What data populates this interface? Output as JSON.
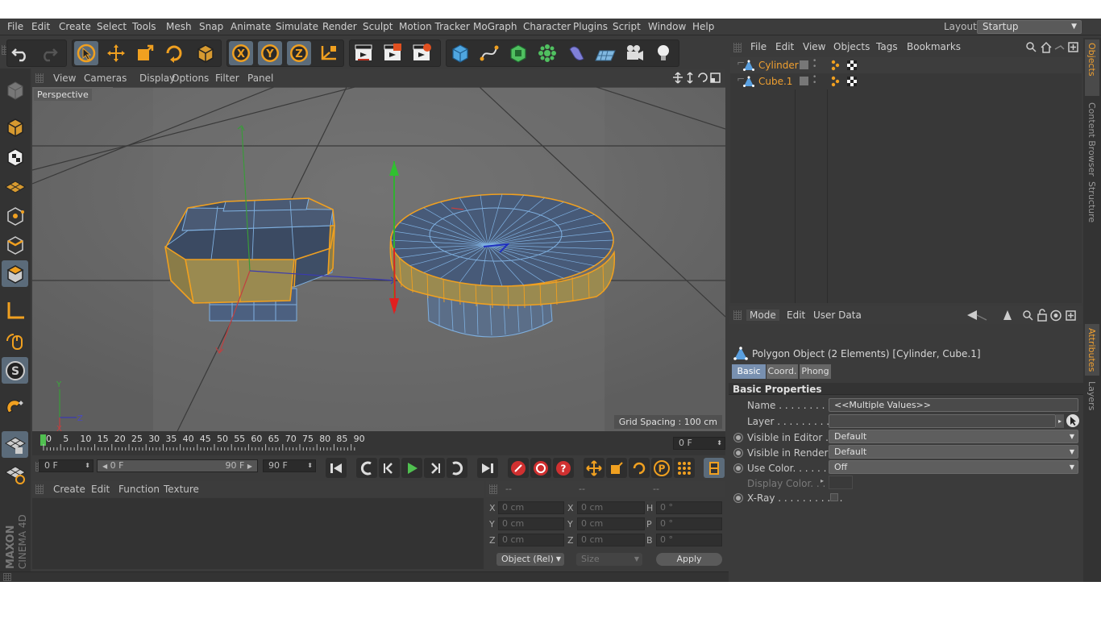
{
  "menu": {
    "items": [
      "File",
      "Edit",
      "Create",
      "Select",
      "Tools",
      "Mesh",
      "Snap",
      "Animate",
      "Simulate",
      "Render",
      "Sculpt",
      "Motion Tracker",
      "MoGraph",
      "Character",
      "Plugins",
      "Script",
      "Window",
      "Help"
    ],
    "layout_label": "Layout:",
    "layout_value": "Startup"
  },
  "viewport": {
    "menu": [
      "View",
      "Cameras",
      "Display",
      "Options",
      "Filter",
      "Panel"
    ],
    "name": "Perspective",
    "grid_spacing": "Grid Spacing : 100 cm",
    "axis_y": "Y",
    "axis_z": "Z",
    "axis_x": "X"
  },
  "timeline": {
    "ticks": [
      "0",
      "5",
      "10",
      "15",
      "20",
      "25",
      "30",
      "35",
      "40",
      "45",
      "50",
      "55",
      "60",
      "65",
      "70",
      "75",
      "80",
      "85",
      "90"
    ],
    "current_frame": "0 F",
    "start_field": "0 F",
    "range_start": "0 F",
    "range_end": "90 F",
    "end_field": "90 F"
  },
  "material": {
    "menu": [
      "Create",
      "Edit",
      "Function",
      "Texture"
    ]
  },
  "coords": {
    "headers": [
      "--",
      "--",
      "--"
    ],
    "pos": [
      {
        "label": "X",
        "value": "0 cm"
      },
      {
        "label": "Y",
        "value": "0 cm"
      },
      {
        "label": "Z",
        "value": "0 cm"
      }
    ],
    "size": [
      {
        "label": "X",
        "value": "0 cm"
      },
      {
        "label": "Y",
        "value": "0 cm"
      },
      {
        "label": "Z",
        "value": "0 cm"
      }
    ],
    "rot": [
      {
        "label": "H",
        "value": "0 °"
      },
      {
        "label": "P",
        "value": "0 °"
      },
      {
        "label": "B",
        "value": "0 °"
      }
    ],
    "mode_select": "Object (Rel)",
    "size_select": "Size",
    "apply": "Apply"
  },
  "objects": {
    "menu": [
      "File",
      "Edit",
      "View",
      "Objects",
      "Tags",
      "Bookmarks"
    ],
    "items": [
      {
        "name": "Cylinder"
      },
      {
        "name": "Cube.1"
      }
    ]
  },
  "attributes": {
    "menu": [
      "Mode",
      "Edit",
      "User Data"
    ],
    "title": "Polygon Object (2 Elements) [Cylinder, Cube.1]",
    "tabs": [
      "Basic",
      "Coord.",
      "Phong"
    ],
    "section": "Basic Properties",
    "props": {
      "name_label": "Name . . . . . . . . . . .",
      "name_value": "<<Multiple Values>>",
      "layer_label": "Layer . . . . . . . . . . .",
      "vis_editor_label": "Visible in Editor . .",
      "vis_editor_value": "Default",
      "vis_render_label": "Visible in Renderer",
      "vis_render_value": "Default",
      "use_color_label": "Use Color. . . . . . . .",
      "use_color_value": "Off",
      "display_color_label": "Display Color. . .",
      "xray_label": "X-Ray . . . . . . . . . . ."
    }
  },
  "side_tabs": [
    "Objects",
    "Content Browser",
    "Structure",
    "Attributes",
    "Layers"
  ],
  "brand": {
    "maxon": "MAXON",
    "cinema": "CINEMA 4D"
  },
  "colors": {
    "accent": "#f0a020",
    "selected": "#5b6b7a",
    "viewport": "#6a6a6a",
    "object_label": "#f0a030"
  }
}
